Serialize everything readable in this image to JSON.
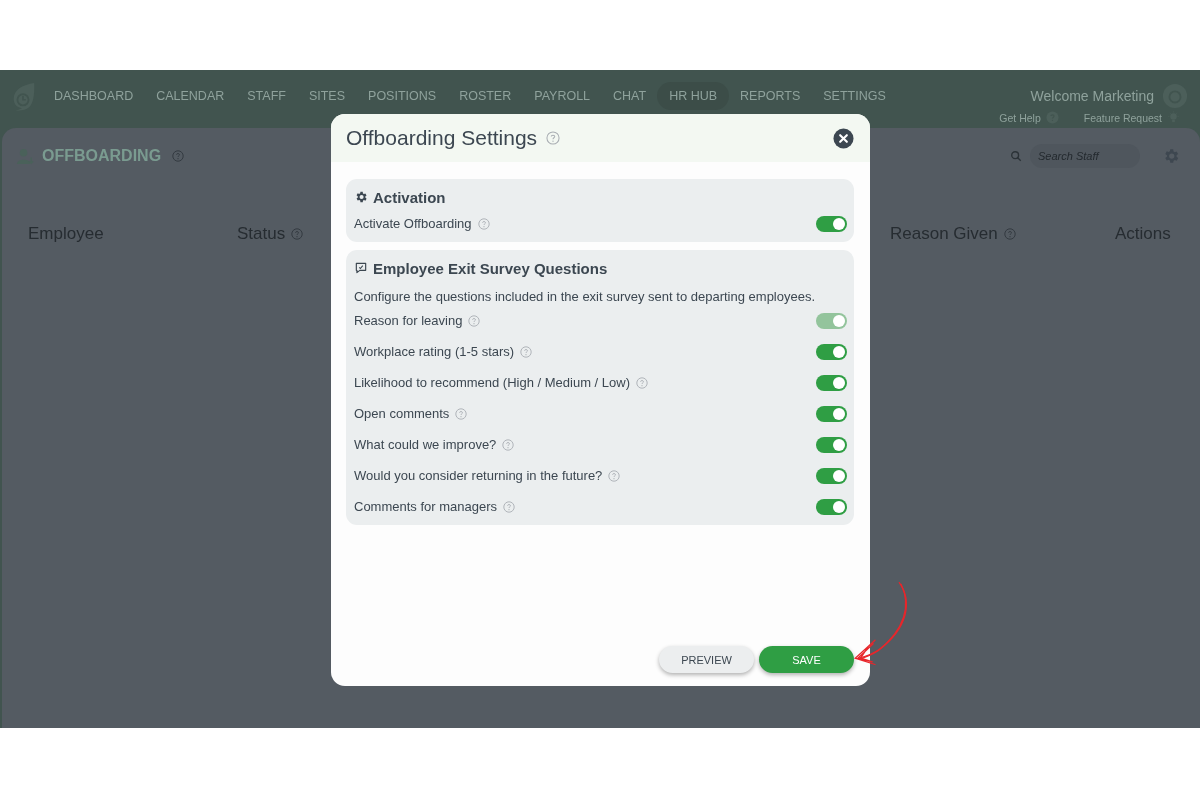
{
  "nav": {
    "items": [
      {
        "label": "DASHBOARD",
        "selected": false
      },
      {
        "label": "CALENDAR",
        "selected": false
      },
      {
        "label": "STAFF",
        "selected": false
      },
      {
        "label": "SITES",
        "selected": false
      },
      {
        "label": "POSITIONS",
        "selected": false
      },
      {
        "label": "ROSTER",
        "selected": false
      },
      {
        "label": "PAYROLL",
        "selected": false
      },
      {
        "label": "CHAT",
        "selected": false
      },
      {
        "label": "HR HUB",
        "selected": true
      },
      {
        "label": "REPORTS",
        "selected": false
      },
      {
        "label": "SETTINGS",
        "selected": false
      }
    ],
    "welcome": "Welcome Marketing",
    "links": [
      {
        "label": "Get Help"
      },
      {
        "label": "Feature Request"
      }
    ]
  },
  "page": {
    "title": "OFFBOARDING",
    "search": {
      "placeholder": "Search Staff"
    },
    "columns": [
      {
        "label": "Employee",
        "help": false
      },
      {
        "label": "Status",
        "help": true
      },
      {
        "label": "Reason Given",
        "help": true
      },
      {
        "label": "Actions",
        "help": false
      }
    ]
  },
  "modal": {
    "title": "Offboarding Settings",
    "sections": [
      {
        "title": "Activation",
        "settings": [
          {
            "label": "Activate Offboarding",
            "on": true,
            "disabled": false
          }
        ]
      },
      {
        "title": "Employee Exit Survey Questions",
        "description": "Configure the questions included in the exit survey sent to departing employees.",
        "settings": [
          {
            "label": "Reason for leaving",
            "on": true,
            "disabled": true
          },
          {
            "label": "Workplace rating (1-5 stars)",
            "on": true,
            "disabled": false
          },
          {
            "label": "Likelihood to recommend (High / Medium / Low)",
            "on": true,
            "disabled": false
          },
          {
            "label": "Open comments",
            "on": true,
            "disabled": false
          },
          {
            "label": "What could we improve?",
            "on": true,
            "disabled": false
          },
          {
            "label": "Would you consider returning in the future?",
            "on": true,
            "disabled": false
          },
          {
            "label": "Comments for managers",
            "on": true,
            "disabled": false
          }
        ]
      }
    ],
    "buttons": [
      {
        "label": "PREVIEW",
        "kind": "secondary"
      },
      {
        "label": "SAVE",
        "kind": "primary"
      }
    ]
  }
}
